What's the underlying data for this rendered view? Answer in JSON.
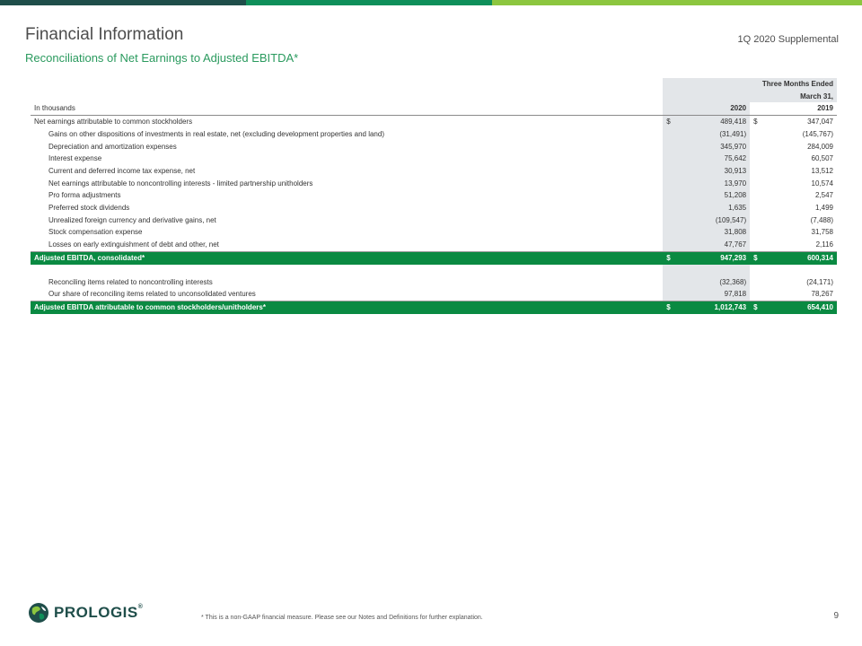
{
  "header": {
    "title": "Financial Information",
    "subtitle": "Reconciliations of Net Earnings to Adjusted EBITDA*",
    "supplemental": "1Q 2020 Supplemental"
  },
  "table": {
    "period_header": "Three Months Ended",
    "period_subheader": "March 31,",
    "unit_label": "In thousands",
    "col_2020": "2020",
    "col_2019": "2019",
    "rows": [
      {
        "label": "Net earnings attributable to common stockholders",
        "d1": "$",
        "v2020": "489,418",
        "d2": "$",
        "v2019": "347,047"
      },
      {
        "label": "Gains on other dispositions of investments in real estate, net (excluding development properties and land)",
        "d1": "",
        "v2020": "(31,491)",
        "d2": "",
        "v2019": "(145,767)"
      },
      {
        "label": "Depreciation and amortization expenses",
        "d1": "",
        "v2020": "345,970",
        "d2": "",
        "v2019": "284,009"
      },
      {
        "label": "Interest expense",
        "d1": "",
        "v2020": "75,642",
        "d2": "",
        "v2019": "60,507"
      },
      {
        "label": "Current and deferred income tax expense, net",
        "d1": "",
        "v2020": "30,913",
        "d2": "",
        "v2019": "13,512"
      },
      {
        "label": "Net earnings attributable to noncontrolling interests - limited partnership unitholders",
        "d1": "",
        "v2020": "13,970",
        "d2": "",
        "v2019": "10,574"
      },
      {
        "label": "Pro forma adjustments",
        "d1": "",
        "v2020": "51,208",
        "d2": "",
        "v2019": "2,547"
      },
      {
        "label": "Preferred stock dividends",
        "d1": "",
        "v2020": "1,635",
        "d2": "",
        "v2019": "1,499"
      },
      {
        "label": "Unrealized foreign currency and derivative gains, net",
        "d1": "",
        "v2020": "(109,547)",
        "d2": "",
        "v2019": "(7,488)"
      },
      {
        "label": "Stock compensation expense",
        "d1": "",
        "v2020": "31,808",
        "d2": "",
        "v2019": "31,758"
      },
      {
        "label": "Losses on early extinguishment of debt and other, net",
        "d1": "",
        "v2020": "47,767",
        "d2": "",
        "v2019": "2,116"
      }
    ],
    "total1": {
      "label": "Adjusted EBITDA, consolidated*",
      "d1": "$",
      "v2020": "947,293",
      "d2": "$",
      "v2019": "600,314"
    },
    "rows2": [
      {
        "label": "Reconciling items related to noncontrolling interests",
        "d1": "",
        "v2020": "(32,368)",
        "d2": "",
        "v2019": "(24,171)"
      },
      {
        "label": "Our share of reconciling items related to unconsolidated ventures",
        "d1": "",
        "v2020": "97,818",
        "d2": "",
        "v2019": "78,267"
      }
    ],
    "total2": {
      "label": "Adjusted EBITDA attributable to common stockholders/unitholders*",
      "d1": "$",
      "v2020": "1,012,743",
      "d2": "$",
      "v2019": "654,410"
    }
  },
  "footer": {
    "logo_text": "PROLOGIS",
    "logo_mark": "®",
    "footnote": "* This is a non-GAAP financial measure.  Please see our Notes and Definitions for further explanation.",
    "page_number": "9"
  },
  "colors": {
    "brand_dark": "#1f4e4a",
    "brand_green": "#0a8a42",
    "brand_lime": "#8cc63f",
    "shade": "#e3e6e9"
  }
}
